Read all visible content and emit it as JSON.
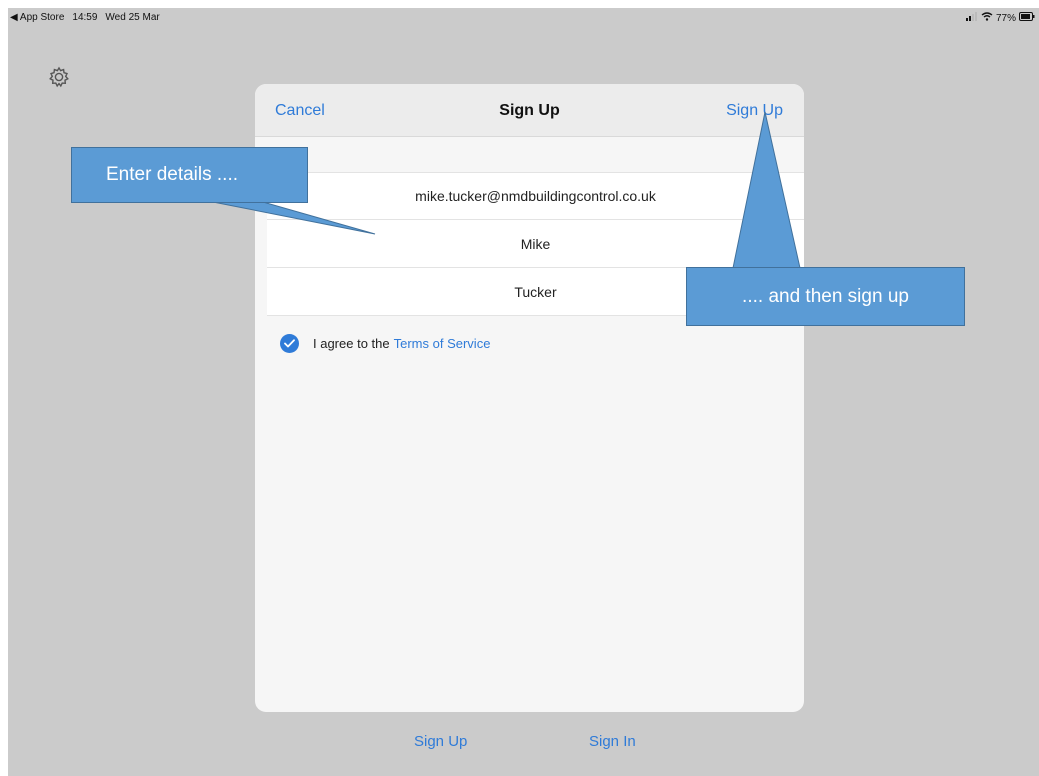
{
  "status_bar": {
    "back_app": "◀ App Store",
    "time": "14:59",
    "date": "Wed 25 Mar",
    "battery_percent": "77%"
  },
  "header": {
    "cancel_label": "Cancel",
    "title": "Sign Up",
    "signup_label": "Sign Up"
  },
  "form": {
    "email_value": "mike.tucker@nmdbuildingcontrol.co.uk",
    "first_name_value": "Mike",
    "last_name_value": "Tucker",
    "agree_text": "I agree to the",
    "terms_link": "Terms of Service",
    "agree_checked": true
  },
  "bottom_nav": {
    "signup_label": "Sign Up",
    "signin_label": "Sign In"
  },
  "callouts": {
    "enter_details": "Enter details ....",
    "then_signup": ".... and then sign up"
  },
  "colors": {
    "accent": "#2f7bd8",
    "background": "#cbcbcb",
    "callout_fill": "#5b9bd5",
    "callout_border": "#41719c"
  },
  "icons": {
    "settings": "gear-icon",
    "checkbox": "checkmark-circle-icon",
    "wifi": "wifi-icon",
    "signal": "signal-icon",
    "battery": "battery-icon"
  }
}
